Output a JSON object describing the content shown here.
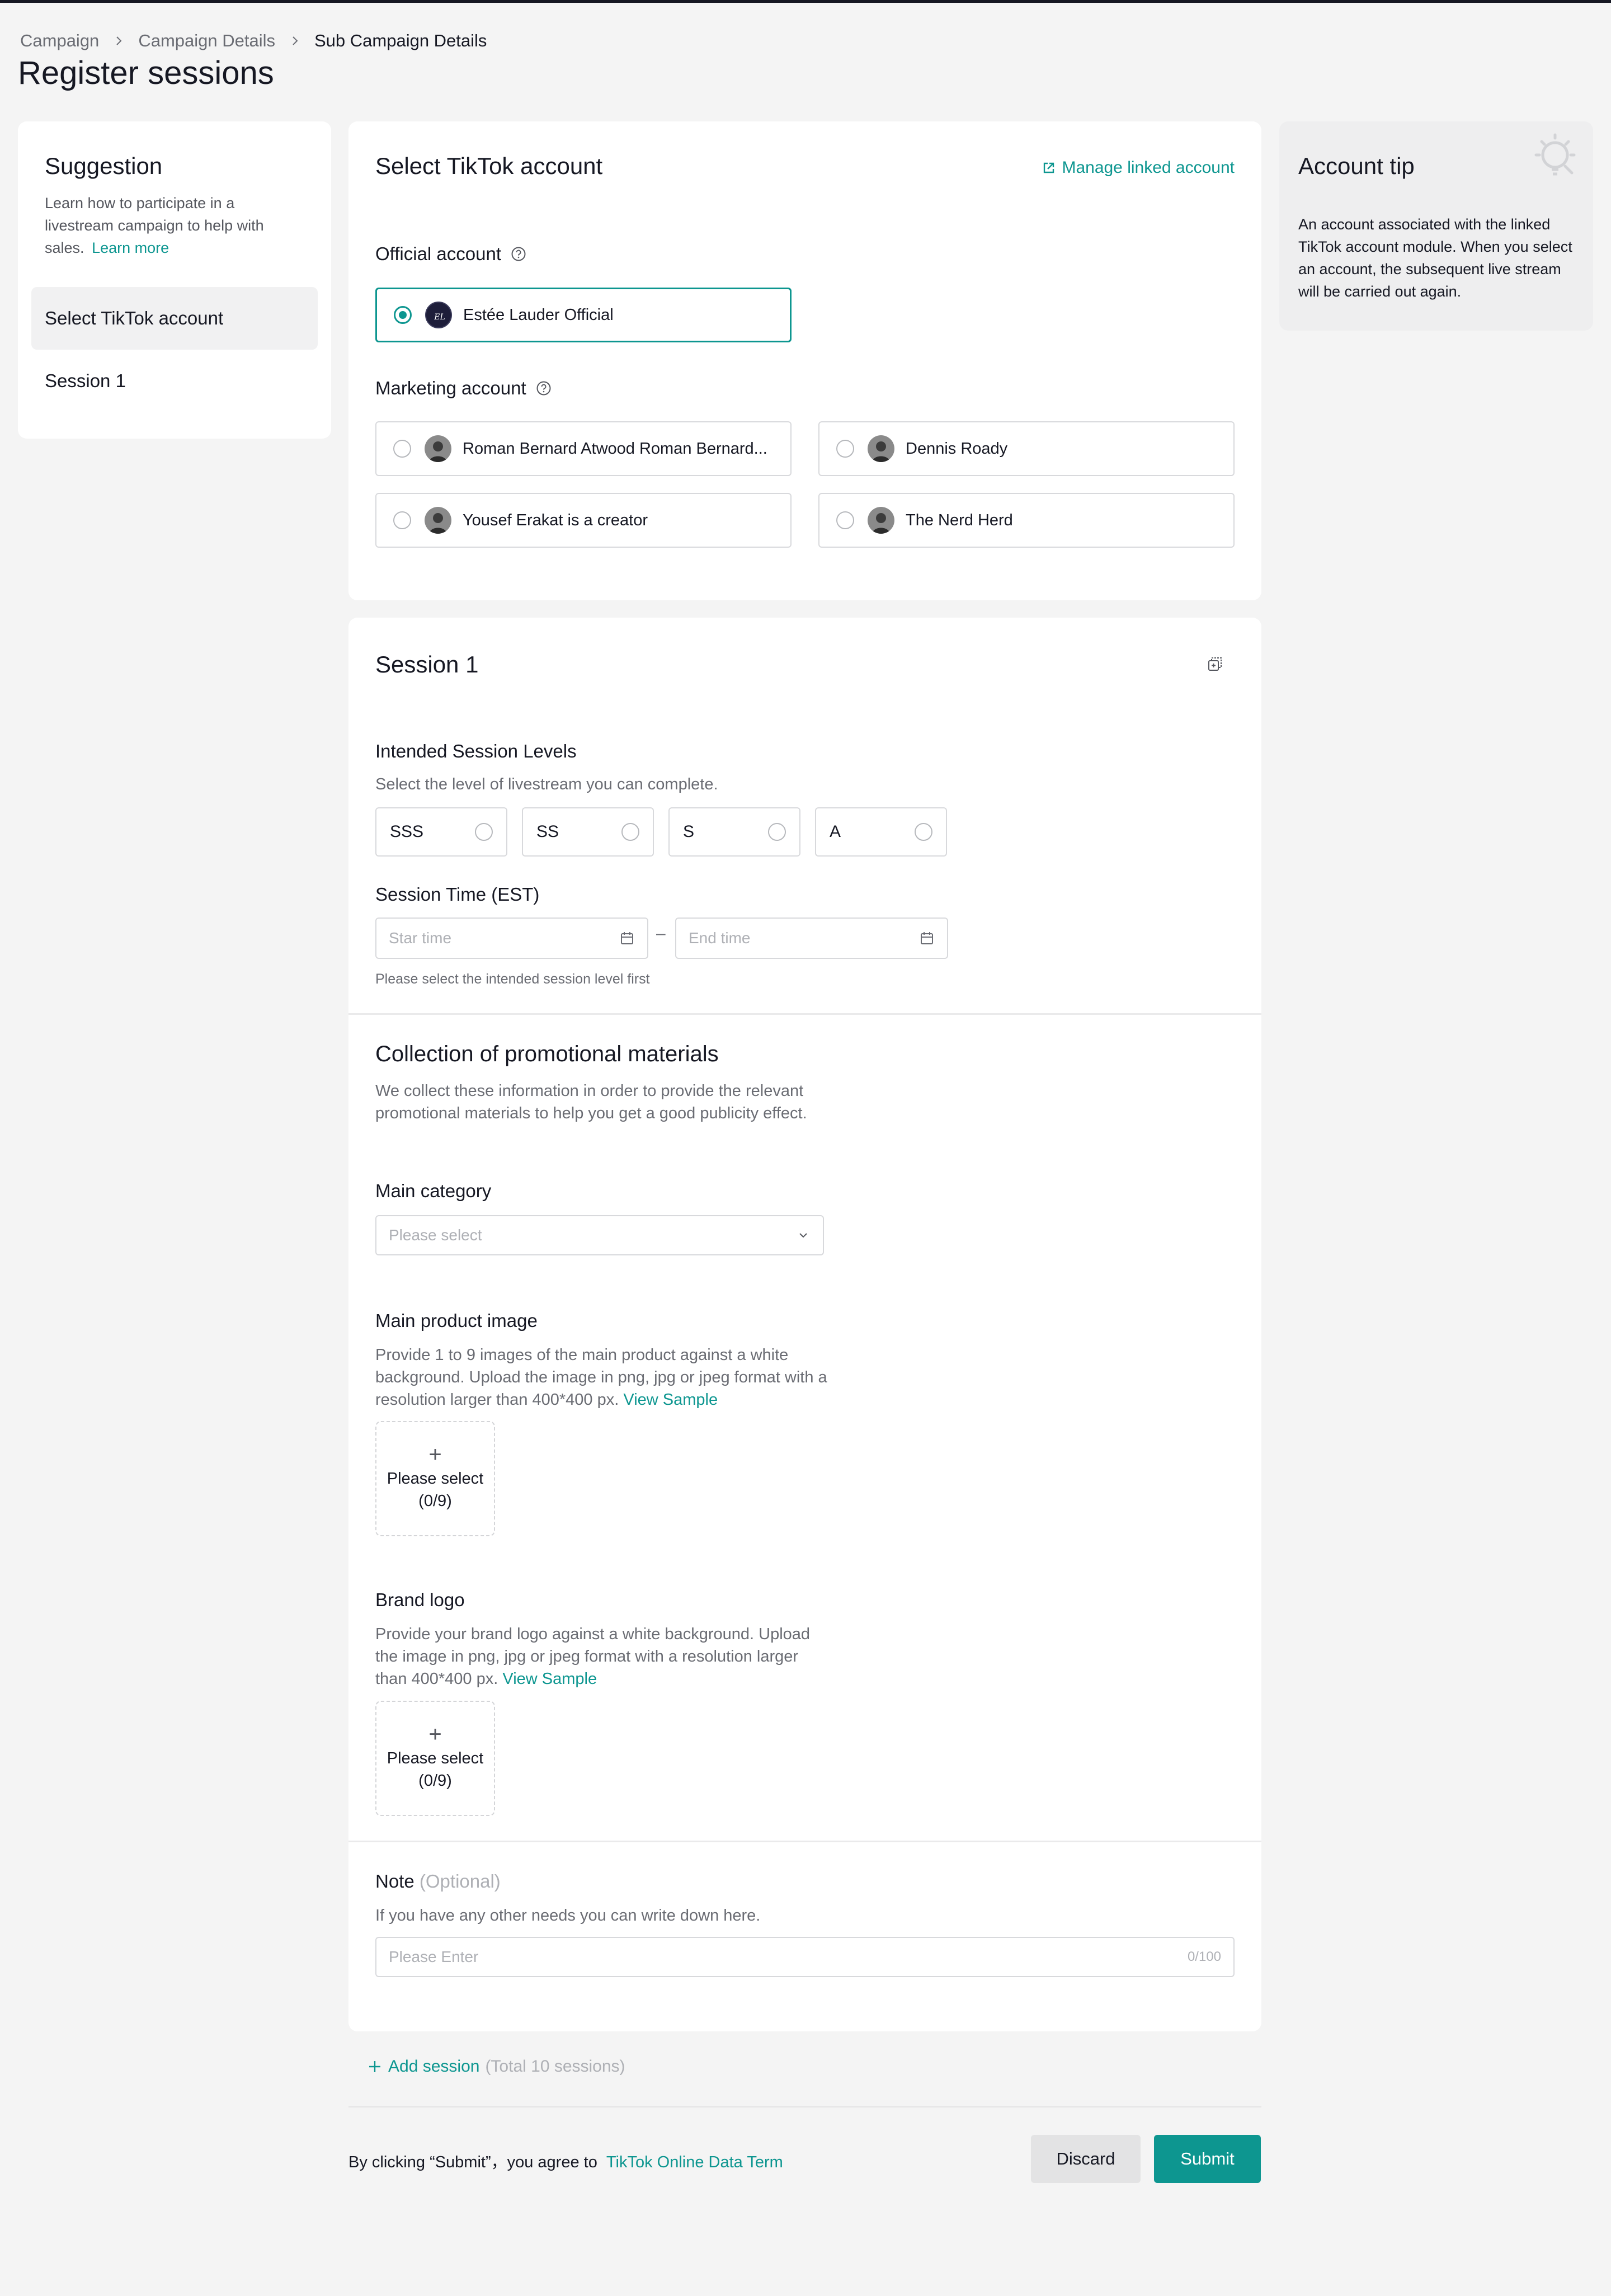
{
  "breadcrumb": [
    "Campaign",
    "Campaign Details",
    "Sub Campaign Details"
  ],
  "page_title": "Register sessions",
  "suggestion": {
    "title": "Suggestion",
    "desc": "Learn how to participate in a livestream campaign to help with sales.",
    "learn_more": "Learn more",
    "nav": [
      "Select TikTok account",
      "Session 1"
    ]
  },
  "select_account": {
    "title": "Select TikTok account",
    "manage_link": "Manage linked account",
    "official_label": "Official account",
    "official": [
      "Estée Lauder Official"
    ],
    "marketing_label": "Marketing account",
    "marketing": [
      "Roman Bernard Atwood Roman Bernard...",
      "Dennis Roady",
      "Yousef Erakat is a creator",
      "The Nerd Herd"
    ]
  },
  "session": {
    "title": "Session 1",
    "levels_label": "Intended Session Levels",
    "levels_desc": "Select the level of livestream you can complete.",
    "levels": [
      "SSS",
      "SS",
      "S",
      "A"
    ],
    "time_label": "Session Time (EST)",
    "start_placeholder": "Star time",
    "end_placeholder": "End time",
    "time_sep": "–",
    "time_hint": "Please select the intended session level first"
  },
  "promo": {
    "title": "Collection of promotional materials",
    "desc": "We collect these information in order to provide the relevant promotional materials to help you get a good publicity effect.",
    "category_label": "Main category",
    "category_placeholder": "Please select",
    "image_label": "Main product image",
    "image_desc": "Provide 1 to 9 images of the main product against a white background. Upload the image in png, jpg or jpeg format with a resolution larger than 400*400 px.",
    "view_sample": "View Sample",
    "upload_label": "Please select",
    "upload_count": "(0/9)",
    "logo_label": "Brand logo",
    "logo_desc": "Provide your brand logo against a white background. Upload the image in png, jpg or jpeg format with a resolution larger than 400*400 px."
  },
  "note": {
    "label": "Note",
    "optional": "(Optional)",
    "desc": "If you have any other needs you can write down here.",
    "placeholder": "Please Enter",
    "counter": "0/100"
  },
  "add_session": {
    "label": "Add session",
    "total": "(Total 10 sessions)"
  },
  "footer": {
    "agree_text": "By clicking “Submit”，you agree to",
    "term_link": "TikTok Online Data Term",
    "discard": "Discard",
    "submit": "Submit"
  },
  "tip": {
    "title": "Account tip",
    "body": "An account associated with the linked TikTok account module. When you select an account, the subsequent live stream will be carried out again."
  },
  "colors": {
    "accent": "#0d9690",
    "background": "#f4f4f4",
    "text": "#161823"
  },
  "icons": [
    "chevron-right-icon",
    "help-icon",
    "external-link-icon",
    "copy-icon",
    "calendar-icon",
    "chevron-down-icon",
    "plus-icon",
    "lightbulb-icon"
  ]
}
